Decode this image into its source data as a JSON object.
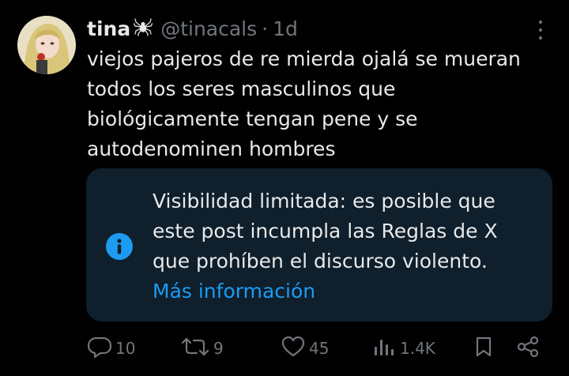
{
  "tweet": {
    "author": {
      "display_name": "tina",
      "handle": "@tinacals",
      "badge_icon": "spider-icon"
    },
    "separator": "·",
    "timestamp": "1d",
    "text_lines": [
      "viejos pajeros de re mierda ojalá se mueran",
      "todos los seres masculinos que",
      "biológicamente tengan pene y se",
      "autodenominen hombres"
    ]
  },
  "notice": {
    "icon": "info-icon",
    "text_lines": [
      "Visibilidad limitada: es posible que",
      "este post incumpla las Reglas de X",
      "que prohíben el discurso violento."
    ],
    "link_text": "Más información"
  },
  "actions": {
    "replies": "10",
    "reposts": "9",
    "likes": "45",
    "views": "1.4K"
  },
  "colors": {
    "background": "#000000",
    "text": "#e7e9ea",
    "muted": "#71767b",
    "link": "#1d9bf0",
    "notice_bg": "#0f1f2c"
  }
}
